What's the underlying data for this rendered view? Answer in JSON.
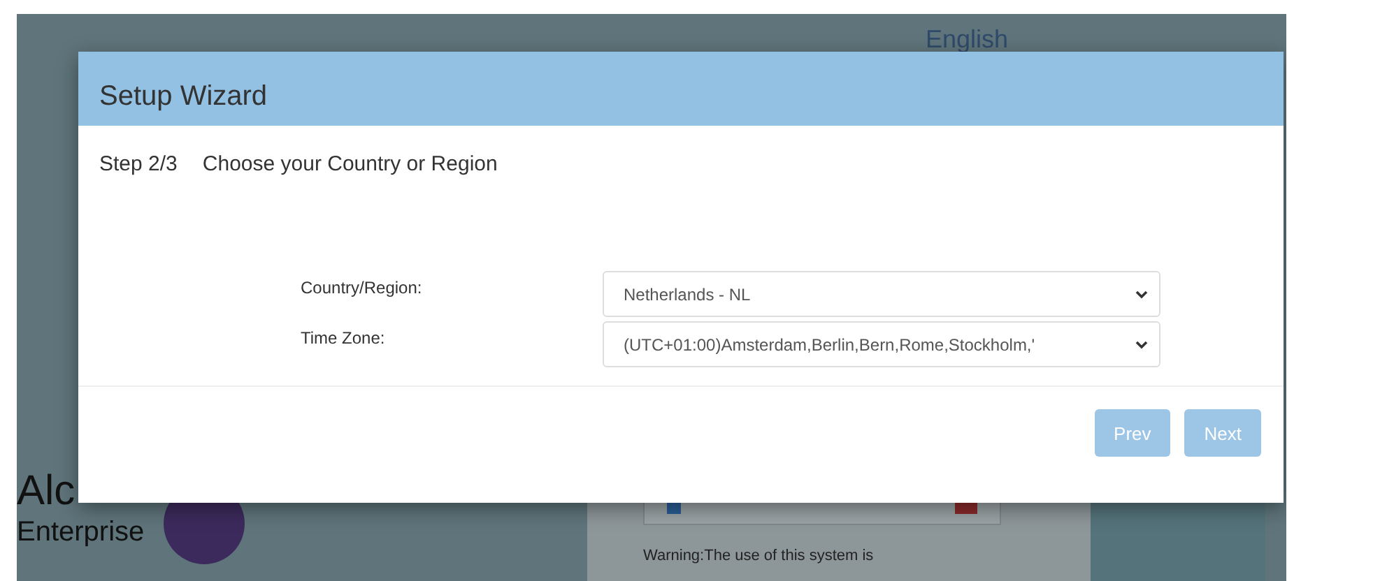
{
  "background": {
    "language": "English",
    "brand": {
      "name": "Alc",
      "subtitle": "Enterprise"
    },
    "login": {
      "warning": "Warning:The use of this system is"
    }
  },
  "dialog": {
    "title": "Setup Wizard",
    "step": "Step 2/3",
    "heading": "Choose your Country or Region",
    "fields": [
      {
        "label": "Country/Region:",
        "value": "Netherlands - NL"
      },
      {
        "label": "Time Zone:",
        "value": "(UTC+01:00)Amsterdam,Berlin,Bern,Rome,Stockholm,'"
      }
    ],
    "buttons": [
      {
        "label": "Prev",
        "disabled": true
      },
      {
        "label": "Next",
        "disabled": true
      }
    ]
  }
}
